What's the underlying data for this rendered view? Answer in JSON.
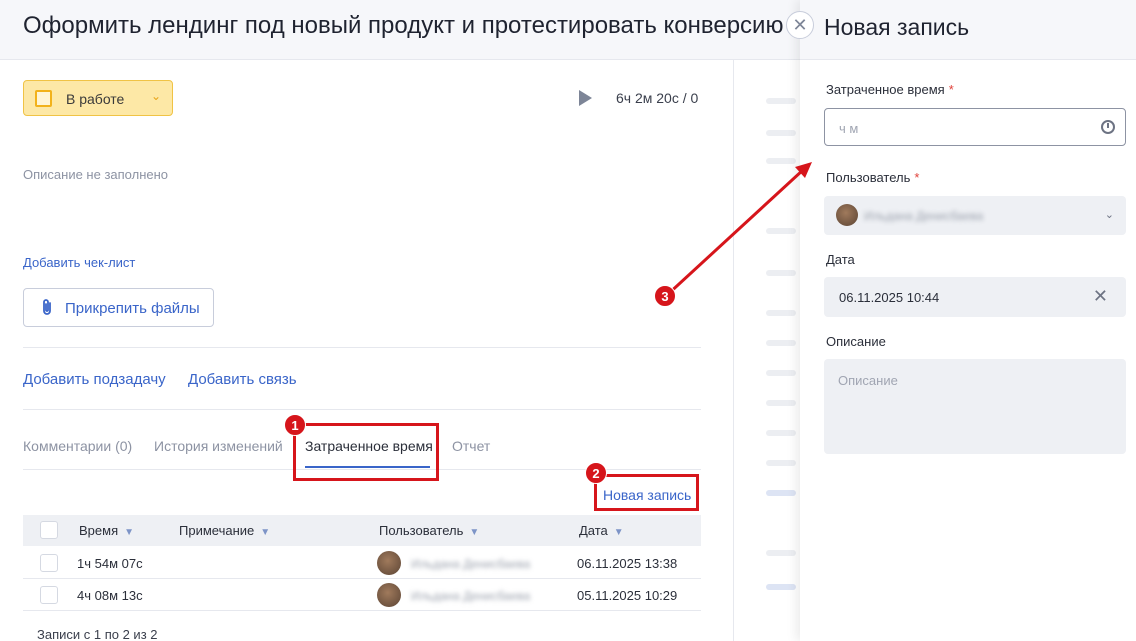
{
  "task": {
    "title": "Оформить лендинг под новый продукт и протестировать конверсию"
  },
  "status": {
    "label": "В работе"
  },
  "timer": {
    "value": "6ч 2м 20с / 0"
  },
  "description": {
    "empty_text": "Описание не заполнено"
  },
  "actions": {
    "add_checklist": "Добавить чек-лист",
    "attach_files": "Прикрепить файлы",
    "add_subtask": "Добавить подзадачу",
    "add_relation": "Добавить связь"
  },
  "tabs": [
    {
      "label": "Комментарии (0)"
    },
    {
      "label": "История изменений"
    },
    {
      "label": "Затраченное время"
    },
    {
      "label": "Отчет"
    }
  ],
  "time_table": {
    "new_record_link": "Новая запись",
    "columns": [
      "Время",
      "Примечание",
      "Пользователь",
      "Дата"
    ],
    "rows": [
      {
        "time": "1ч 54м 07с",
        "note": "",
        "user": "Ильдана Денисбаева",
        "date": "06.11.2025 13:38"
      },
      {
        "time": "4ч 08м 13с",
        "note": "",
        "user": "Ильдана Денисбаева",
        "date": "05.11.2025 10:29"
      }
    ],
    "pager": "Записи с 1 по 2 из 2"
  },
  "drawer": {
    "title": "Новая запись",
    "spent_time": {
      "label": "Затраченное время",
      "required_mark": "*",
      "placeholder": "ч м"
    },
    "user": {
      "label": "Пользователь",
      "required_mark": "*",
      "value": "Ильдана Денисбаева"
    },
    "date": {
      "label": "Дата",
      "value": "06.11.2025 10:44"
    },
    "description": {
      "label": "Описание",
      "placeholder": "Описание"
    }
  },
  "annotations": {
    "badge_1": "1",
    "badge_2": "2",
    "badge_3": "3",
    "color": "#d6151b"
  },
  "icons": {
    "close": "close-icon",
    "play": "play-icon",
    "attach": "paperclip-icon",
    "clock": "clock-icon",
    "clear": "x-icon",
    "chevron": "chevron-down-icon"
  }
}
